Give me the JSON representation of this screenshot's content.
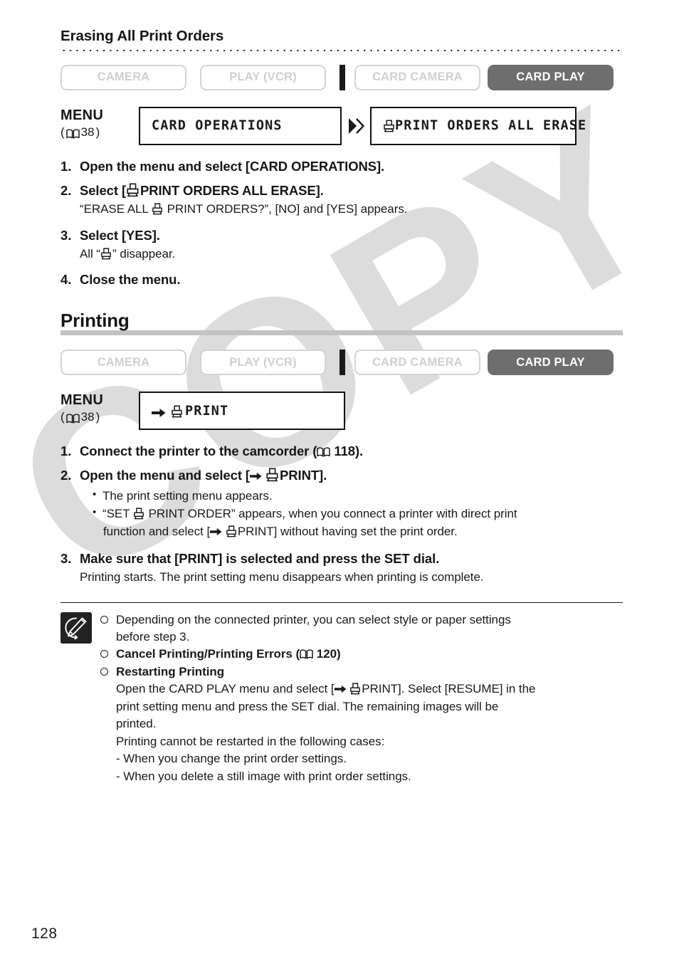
{
  "watermark": {
    "text": "COPY"
  },
  "page_number": "128",
  "section": {
    "title": "Erasing All Print Orders",
    "mode_bar": {
      "camera": "CAMERA",
      "play_vcr": "PLAY (VCR)",
      "card_camera": "CARD CAMERA",
      "card_play": "CARD PLAY",
      "active": "CARD PLAY"
    },
    "menu": {
      "label": "MENU",
      "page_ref_open": "(",
      "page_ref": "38",
      "page_ref_close": ")",
      "box1": "CARD OPERATIONS",
      "box2": "PRINT ORDERS ALL ERASE"
    },
    "steps": [
      {
        "num": "1.",
        "head_a": "Open the menu and select [CARD OPERATIONS]."
      },
      {
        "num": "2.",
        "head_a": "Select [",
        "head_b": "PRINT ORDERS ALL ERASE].",
        "sub_a": "“ERASE ALL",
        "sub_b": "PRINT ORDERS?”, [NO] and [YES] appears."
      },
      {
        "num": "3.",
        "head_a": "Select [YES].",
        "sub_a": "All “",
        "sub_b": "” disappear."
      },
      {
        "num": "4.",
        "head_a": "Close the menu."
      }
    ]
  },
  "printing": {
    "heading": "Printing",
    "mode_bar": {
      "camera": "CAMERA",
      "play_vcr": "PLAY (VCR)",
      "card_camera": "CARD CAMERA",
      "card_play": "CARD PLAY",
      "active": "CARD PLAY"
    },
    "menu": {
      "label": "MENU",
      "page_ref_open": "(",
      "page_ref": "38",
      "page_ref_close": ")",
      "box": "PRINT"
    },
    "steps": [
      {
        "num": "1.",
        "head_a": "Connect the printer to the camcorder (",
        "page_ref": "118",
        "head_b": ")."
      },
      {
        "num": "2.",
        "head_a": "Open the menu and select [",
        "head_b": "PRINT].",
        "bullets": [
          {
            "text_a": "The print setting menu appears."
          },
          {
            "text_a": "“SET",
            "text_b": "PRINT ORDER” appears, when you connect a printer with direct print",
            "cont_a": "function and select [",
            "cont_b": "PRINT] without having set the print order."
          }
        ]
      },
      {
        "num": "3.",
        "head_a": "Make sure that [PRINT] is selected and press the SET dial.",
        "sub_a": "Printing starts. The print setting menu disappears when printing is complete."
      }
    ]
  },
  "notes": [
    {
      "bold": false,
      "text_a": "Depending on the connected printer, you can select style or paper settings",
      "text_b": "before step 3."
    },
    {
      "bold": true,
      "text_a": "Cancel Printing/Printing Errors (",
      "page_ref": "120",
      "text_b": ")"
    },
    {
      "bold": true,
      "text_a": "Restarting Printing"
    }
  ],
  "notes_body": {
    "line1_a": "Open the CARD PLAY menu and select [",
    "line1_b": "PRINT]. Select [RESUME] in the",
    "line2": "print setting menu and press the SET dial. The remaining images will be",
    "line3": "printed.",
    "line4": "Printing cannot be restarted in the following cases:",
    "line5": "-  When you change the print order settings.",
    "line6": "-  When you delete a still image with print order settings."
  },
  "icons": {
    "book": "book-icon",
    "printer": "printer-icon",
    "arrow_right": "arrow-right-icon",
    "double_arrow": "double-arrow-icon",
    "memo": "memo-pencil-icon"
  },
  "colors": {
    "active_button_bg": "#6e6e6e",
    "inactive_button_border": "#d3d3d3",
    "inactive_button_text": "#cfcfcf",
    "rule_gray": "#c2c2c2",
    "watermark": "#dcdcdc",
    "text": "#1a1a1a"
  }
}
